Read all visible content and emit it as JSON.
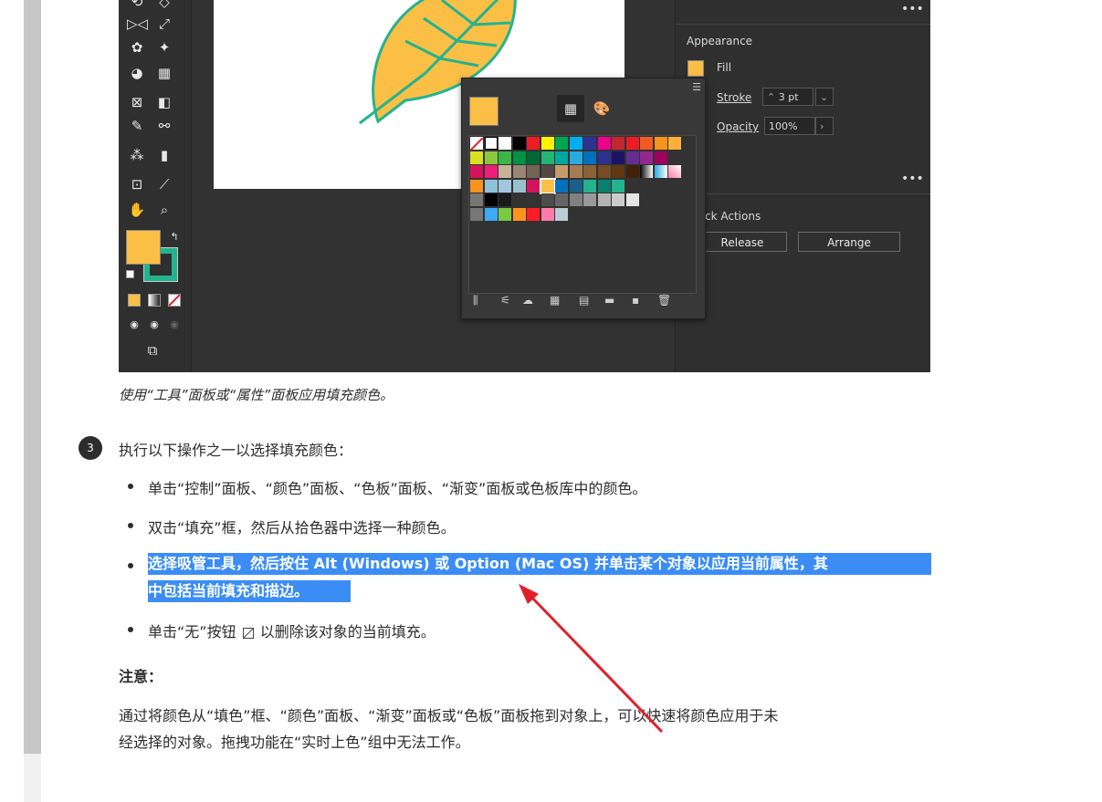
{
  "figure": {
    "toolbar_icons": [
      "reflect-icon",
      "scale-icon",
      "puppet-warp-icon",
      "pin-icon",
      "shape-builder-icon",
      "perspective-icon",
      "mesh-icon",
      "gradient-icon",
      "eyedropper-icon",
      "blend-icon",
      "symbol-sprayer-icon",
      "column-graph-icon",
      "artboard-icon",
      "slice-icon",
      "hand-icon",
      "zoom-icon"
    ],
    "colors": {
      "fill": "#fcbf45",
      "stroke": "#23b38f",
      "leaf_stroke": "#23b38f"
    },
    "right_panel": {
      "appearance_title": "Appearance",
      "fill_label": "Fill",
      "stroke_label": "Stroke",
      "stroke_value": "3 pt",
      "opacity_label": "Opacity",
      "opacity_value": "100%",
      "quick_actions_title": "ck Actions",
      "release_label": "Release",
      "arrange_label": "Arrange",
      "more_glyph": "•••"
    },
    "swatch_popup": {
      "tabs": [
        "swatches-tab-icon",
        "color-tab-icon"
      ],
      "footer_icons": [
        "swatch-libraries-icon",
        "show-kinds-icon",
        "cc-library-icon",
        "swatch-options-icon",
        "new-color-group-icon",
        "folder-icon",
        "new-swatch-icon",
        "delete-icon"
      ]
    }
  },
  "caption": "使用“工具”面板或“属性”面板应用填充颜色。",
  "step": {
    "number": "3",
    "text": "执行以下操作之一以选择填充颜色："
  },
  "bullets": [
    "单击“控制”面板、“颜色”面板、“色板”面板、“渐变”面板或色板库中的颜色。",
    "双击“填充”框，然后从拾色器中选择一种颜色。",
    "选择吸管工具，然后按住 Alt (Windows) 或 Option (Mac OS) 并单击某个对象以应用当前属性，其中包括当前填充和描边。"
  ],
  "highlight_lines": [
    "选择吸管工具，然后按住 Alt (Windows) 或 Option (Mac OS) 并单击某个对象以应用当前属性，其",
    "中包括当前填充和描边。"
  ],
  "bullet4": {
    "before": "单击“无”按钮",
    "after": "以删除该对象的当前填充。"
  },
  "note": {
    "title": "注意：",
    "lines": [
      "通过将颜色从“填色”框、“颜色”面板、“渐变”面板或“色板”面板拖到对象上，可以快速将颜色应用于未",
      "经选择的对象。拖拽功能在“实时上色”组中无法工作。"
    ]
  },
  "annotation": {
    "arrow_color": "#e0202a"
  }
}
